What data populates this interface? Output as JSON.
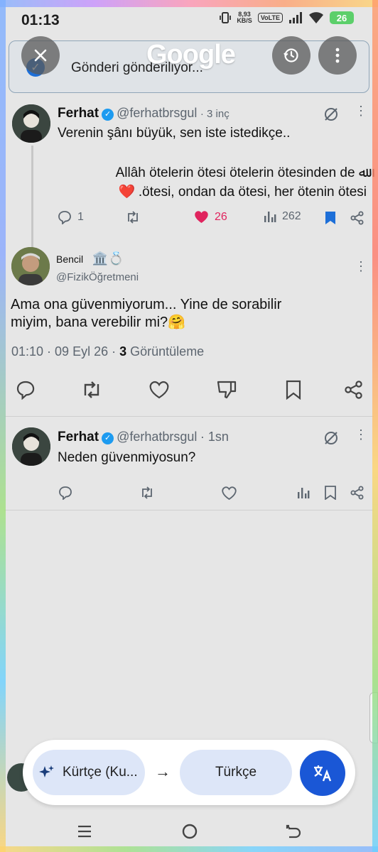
{
  "status": {
    "time": "01:13",
    "net_speed": "8,93",
    "net_unit": "KB/S",
    "volte": "VoLTE",
    "battery": "26"
  },
  "lens": {
    "logo": "Google"
  },
  "toast": {
    "text": "Gönderi gönderiliyor..."
  },
  "tweets": [
    {
      "name": "Ferhat",
      "handle": "@ferhatbrsgul",
      "time": "· 3 inç",
      "line1": "Verenin şânı büyük, sen iste istedikçe..",
      "line2": "Allâh ötelerin ötesi ötelerin ötesinden de ﷲ",
      "line3": ".ötesi, ondan da ötesi, her ötenin ötesi",
      "replies": "1",
      "likes": "26",
      "views": "262"
    },
    {
      "name": "Bencil",
      "name_emoji": "🏛️💍",
      "handle": "@FizikÖğretmeni",
      "line1": "Ama ona güvenmiyorum... Yine de sorabilir",
      "line2": "miyim, bana verebilir mi?🤗",
      "meta_time": "01:10 · 09 Eyl 26 ·",
      "meta_views": "3",
      "meta_views_label": "Görüntüleme"
    },
    {
      "name": "Ferhat",
      "handle": "@ferhatbrsgul",
      "time": "· 1sn",
      "line1": "Neden güvenmiyosun?"
    }
  ],
  "translate": {
    "source": "Kürtçe (Ku...",
    "target": "Türkçe",
    "arrow": "→"
  },
  "icons": {
    "close": "close-icon",
    "history": "history-icon",
    "more": "more-vert-icon",
    "reply": "reply-icon",
    "retweet": "retweet-icon",
    "like": "heart-icon",
    "views": "views-icon",
    "bookmark": "bookmark-icon",
    "share": "share-icon",
    "translate": "translate-icon"
  },
  "colors": {
    "like": "#e0245e",
    "bookmark": "#1d6fd8",
    "verified": "#1d9bf0",
    "translate_btn": "#1a57d6"
  }
}
